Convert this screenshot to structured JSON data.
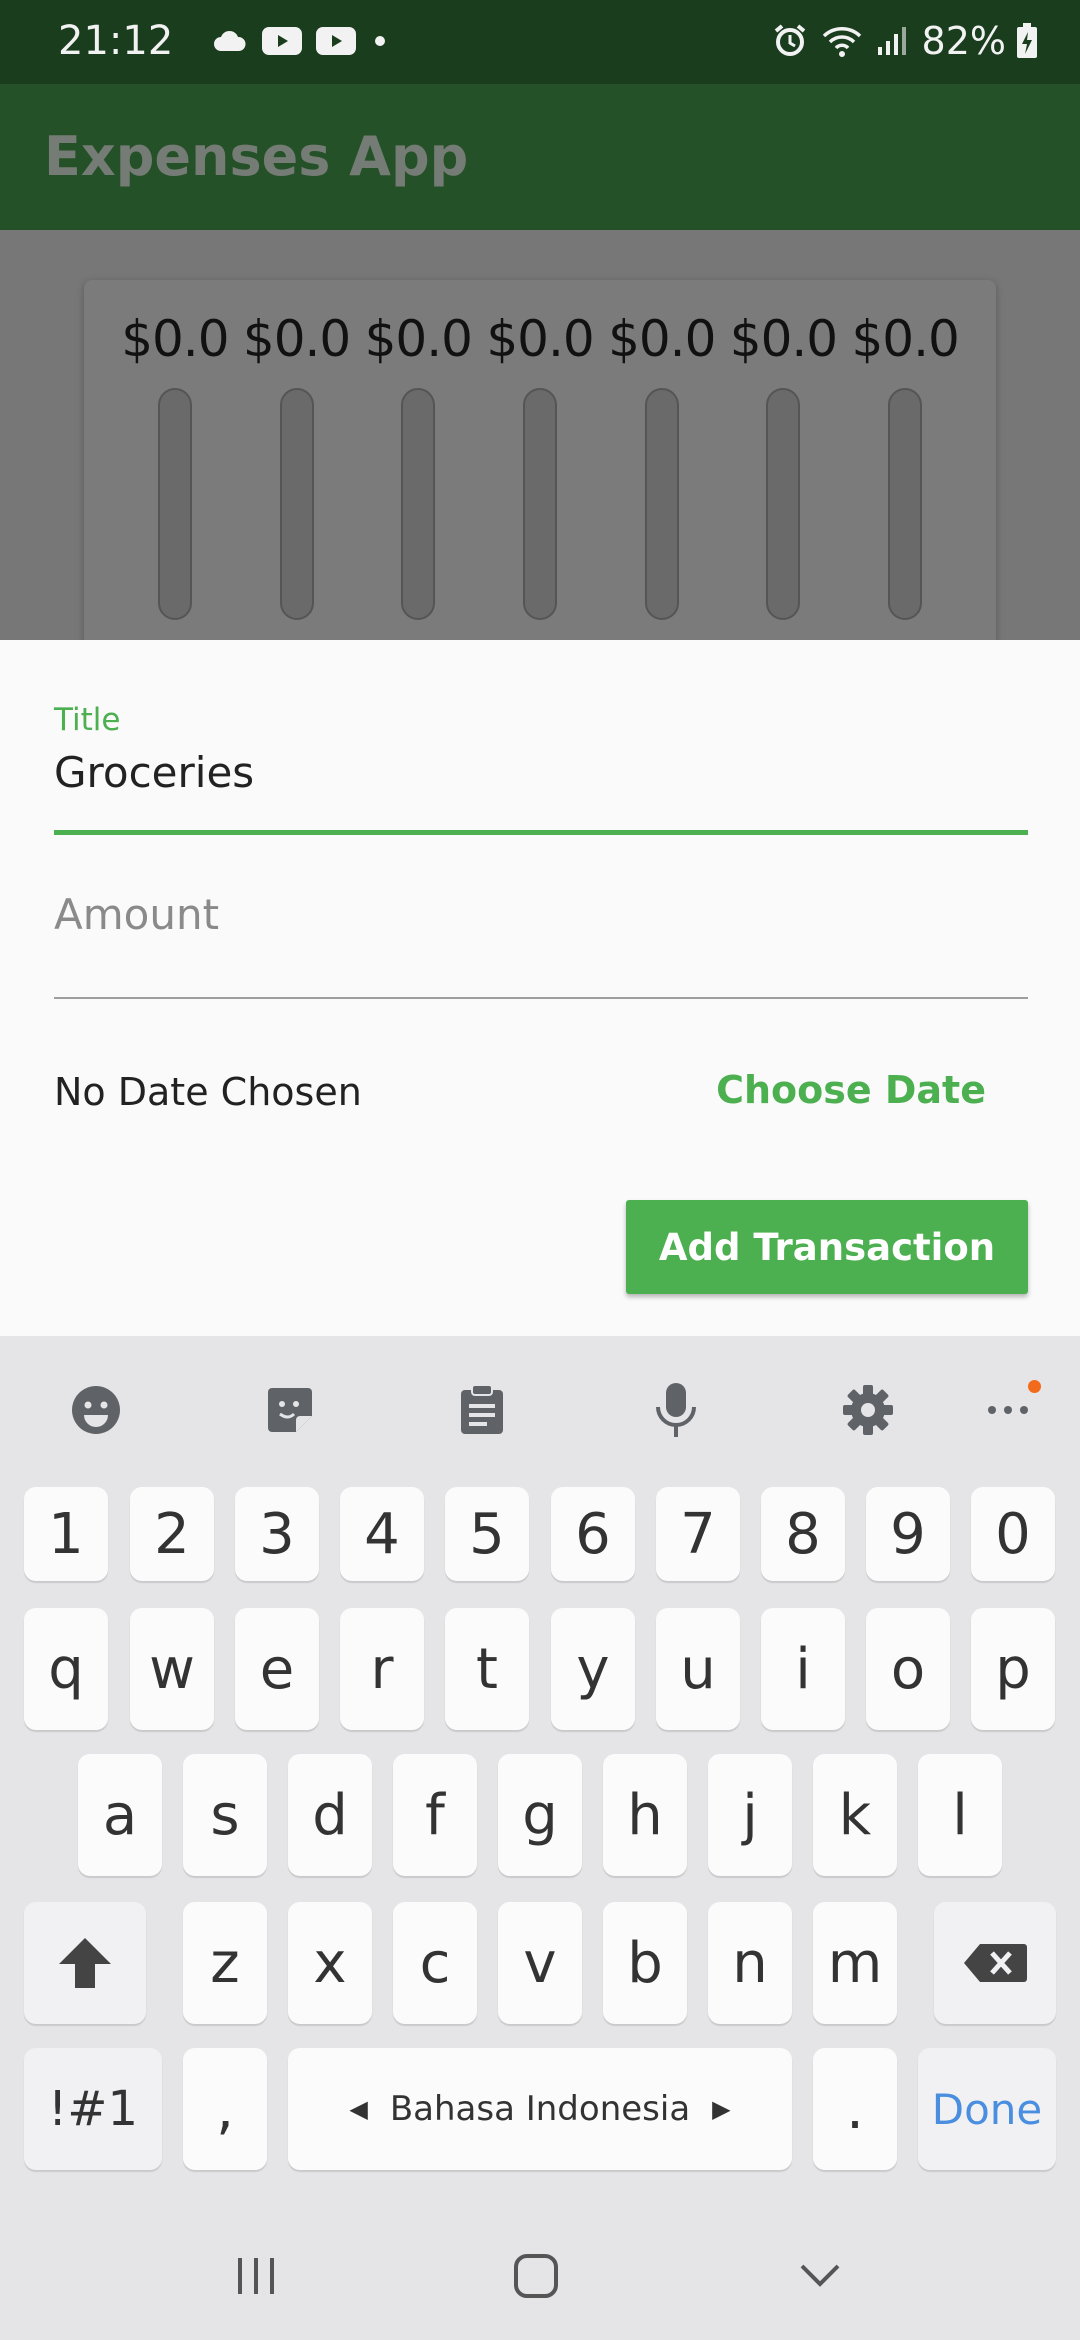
{
  "status_bar": {
    "time": "21:12",
    "battery_percent": "82%",
    "left_icons": [
      "cloud-icon",
      "youtube-icon",
      "youtube-icon",
      "dot-icon"
    ],
    "right_icons": [
      "alarm-icon",
      "wifi-icon",
      "signal-icon",
      "battery-charging-icon"
    ]
  },
  "app_bar": {
    "title": "Expenses App"
  },
  "chart": {
    "amounts": [
      "$0.0",
      "$0.0",
      "$0.0",
      "$0.0",
      "$0.0",
      "$0.0",
      "$0.0"
    ]
  },
  "form": {
    "title_label": "Title",
    "title_value": "Groceries",
    "amount_placeholder": "Amount",
    "date_text": "No Date Chosen",
    "choose_date_label": "Choose Date",
    "submit_label": "Add Transaction",
    "accent_color": "#4caf50"
  },
  "keyboard": {
    "toolbar": [
      "emoji-icon",
      "sticker-icon",
      "clipboard-icon",
      "microphone-icon",
      "settings-icon",
      "more-icon"
    ],
    "number_row": [
      "1",
      "2",
      "3",
      "4",
      "5",
      "6",
      "7",
      "8",
      "9",
      "0"
    ],
    "row1": [
      "q",
      "w",
      "e",
      "r",
      "t",
      "y",
      "u",
      "i",
      "o",
      "p"
    ],
    "row2": [
      "a",
      "s",
      "d",
      "f",
      "g",
      "h",
      "j",
      "k",
      "l"
    ],
    "row3": [
      "z",
      "x",
      "c",
      "v",
      "b",
      "n",
      "m"
    ],
    "symbols_label": "!#1",
    "comma_label": ",",
    "space_label": "Bahasa Indonesia",
    "period_label": ".",
    "done_label": "Done"
  },
  "nav_bar": {
    "buttons": [
      "recents-icon",
      "home-icon",
      "back-icon"
    ]
  }
}
